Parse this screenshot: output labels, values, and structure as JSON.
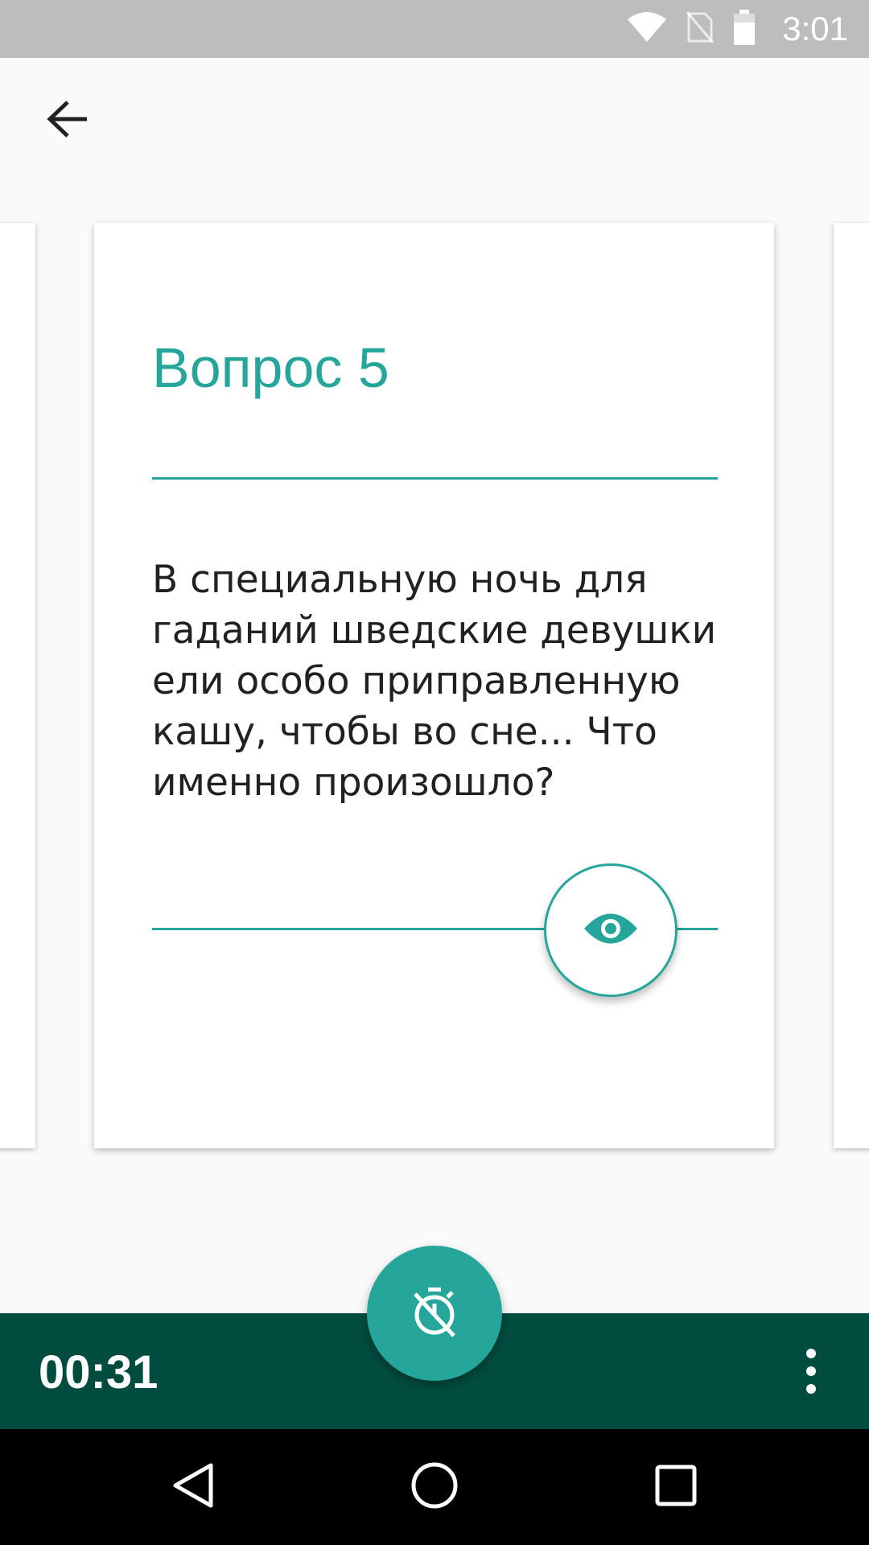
{
  "status_bar": {
    "time": "3:01",
    "icons": [
      "wifi-icon",
      "no-sim-icon",
      "battery-icon"
    ]
  },
  "app_bar": {
    "back_icon": "arrow-back-icon"
  },
  "card": {
    "title": "Вопрос 5",
    "question": "В специальную ночь для гаданий шведские девушки ели особо приправленную кашу, чтобы во сне... Что именно произошло?",
    "reveal_icon": "eye-icon"
  },
  "bottom_bar": {
    "timer": "00:31",
    "timer_button_icon": "timer-off-icon",
    "more_icon": "more-vert-icon"
  },
  "nav_bar": {
    "icons": [
      "back-triangle-icon",
      "home-circle-icon",
      "recents-square-icon"
    ]
  },
  "colors": {
    "accent": "#26a69a",
    "bottom_bar": "#004d40",
    "status_bar": "#bdbdbd",
    "background": "#fafafa"
  }
}
